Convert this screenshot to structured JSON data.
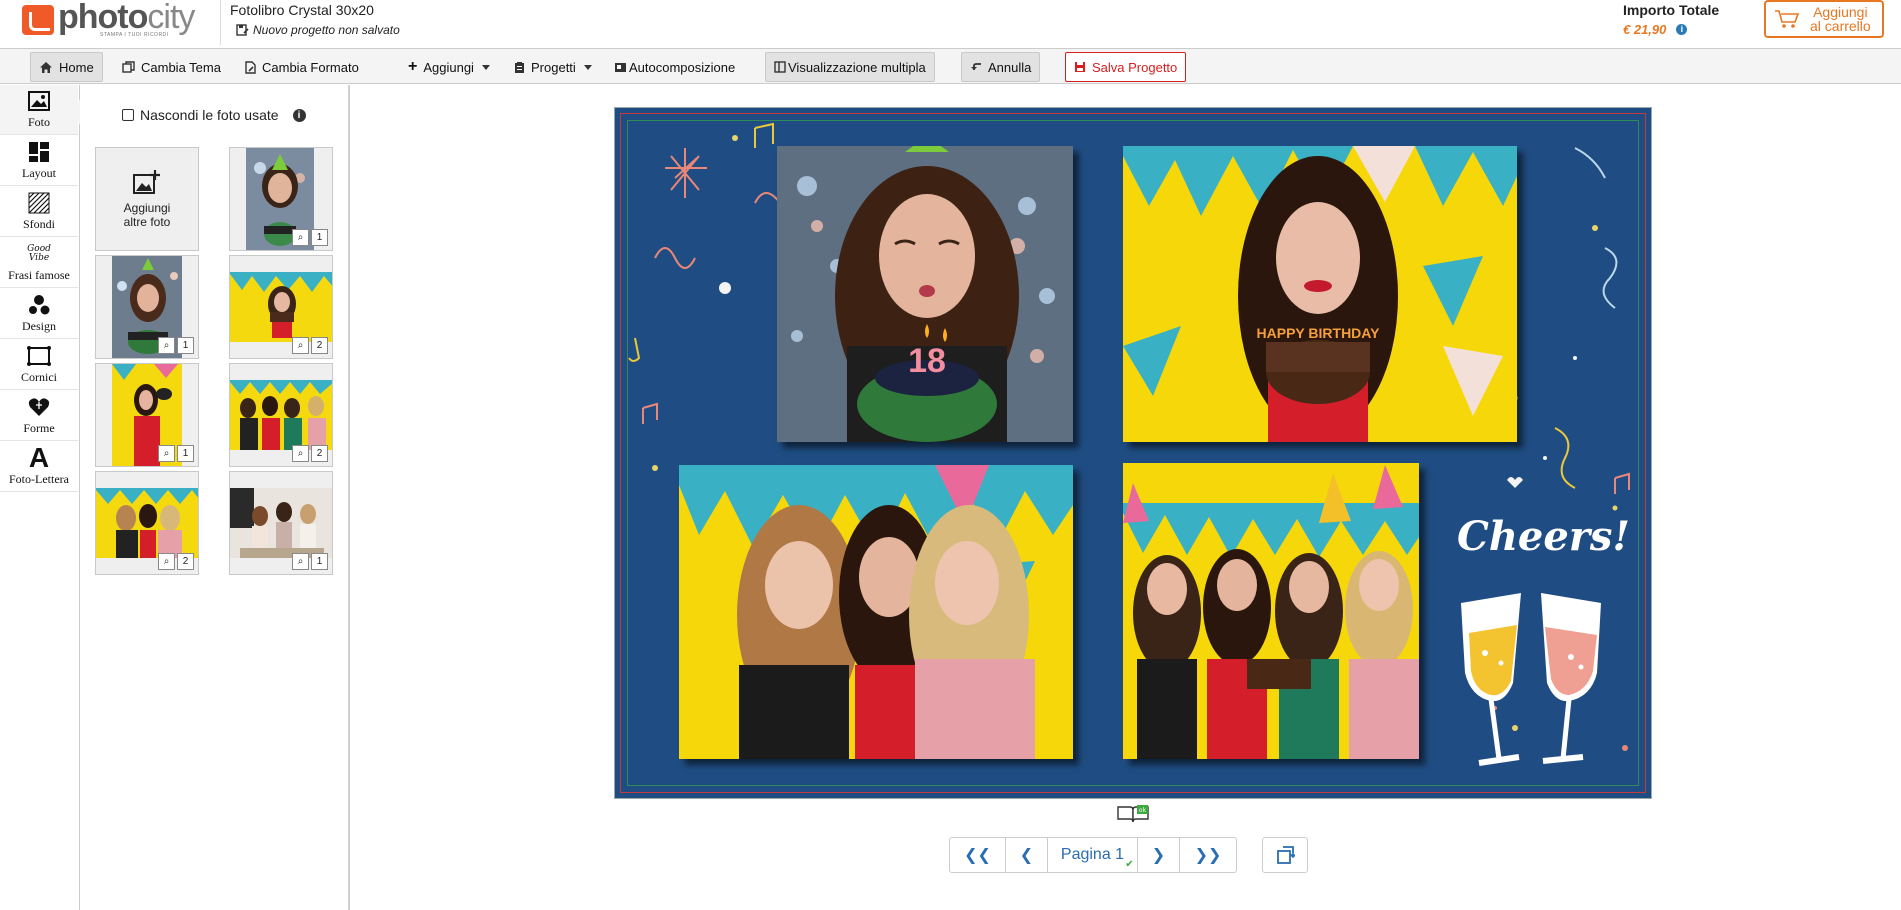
{
  "header": {
    "logo": {
      "brand_a": "photo",
      "brand_b": "city",
      "tagline": "STAMPA I TUOI RICORDI"
    },
    "project_title": "Fotolibro Crystal 30x20",
    "project_status": "Nuovo progetto non salvato",
    "total_label": "Importo Totale",
    "total_value": "€ 21,90",
    "cart_button": {
      "line1": "Aggiungi",
      "line2": "al carrello",
      "icon": "cart-icon"
    },
    "accent_color": "#e87722"
  },
  "toolbar": {
    "home": "Home",
    "change_theme": "Cambia Tema",
    "change_format": "Cambia Formato",
    "add": "Aggiungi",
    "projects": "Progetti",
    "autocompose": "Autocomposizione",
    "multi_view": "Visualizzazione multipla",
    "undo": "Annulla",
    "save": "Salva Progetto"
  },
  "leftbar": {
    "items": [
      {
        "label": "Foto",
        "icon": "photo-icon",
        "active": true
      },
      {
        "label": "Layout",
        "icon": "layout-icon"
      },
      {
        "label": "Sfondi",
        "icon": "background-icon"
      },
      {
        "label": "Frasi famose",
        "icon": "quote-icon",
        "icon_text": "Good Vibe"
      },
      {
        "label": "Design",
        "icon": "design-icon"
      },
      {
        "label": "Cornici",
        "icon": "frame-icon"
      },
      {
        "label": "Forme",
        "icon": "heart-shape-icon"
      },
      {
        "label": "Foto-Lettera",
        "icon": "letter-icon",
        "icon_text": "A"
      }
    ]
  },
  "panel": {
    "hide_used_label": "Nascondi le foto usate",
    "add_more": {
      "line1": "Aggiungi",
      "line2": "altre foto"
    },
    "photos": [
      {
        "name": "birthday-hat-girl",
        "uses": "1"
      },
      {
        "name": "girl-blowing-candles",
        "uses": "1"
      },
      {
        "name": "girl-holding-cake",
        "uses": "2"
      },
      {
        "name": "girl-with-balloon",
        "uses": "1"
      },
      {
        "name": "friends-with-cake",
        "uses": "2"
      },
      {
        "name": "friends-hugging",
        "uses": "2"
      },
      {
        "name": "friends-party-table",
        "uses": "1"
      }
    ]
  },
  "canvas": {
    "cheers_text": "Cheers!",
    "cake_sign": "HAPPY BIRTHDAY",
    "candle_number": "18",
    "background_color": "#1f4d83"
  },
  "pager": {
    "first": "first-page-icon",
    "prev": "prev-page-icon",
    "label": "Pagina 1",
    "next": "next-page-icon",
    "last": "last-page-icon",
    "rotate": "rotate-page-icon"
  }
}
